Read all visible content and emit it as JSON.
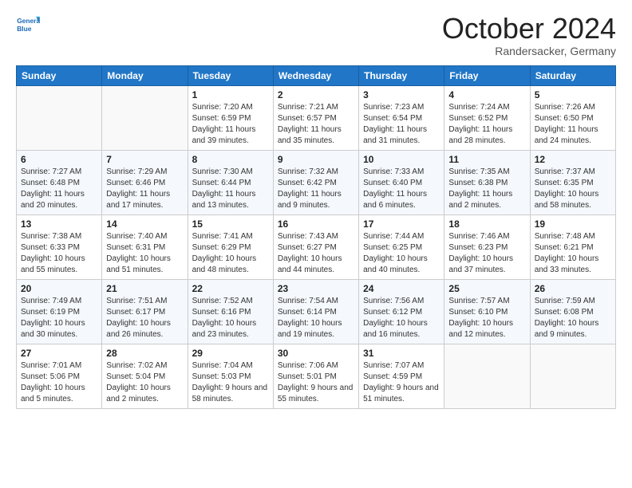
{
  "logo": {
    "line1": "General",
    "line2": "Blue"
  },
  "header": {
    "month": "October 2024",
    "location": "Randersacker, Germany"
  },
  "weekdays": [
    "Sunday",
    "Monday",
    "Tuesday",
    "Wednesday",
    "Thursday",
    "Friday",
    "Saturday"
  ],
  "weeks": [
    [
      {
        "day": "",
        "detail": ""
      },
      {
        "day": "",
        "detail": ""
      },
      {
        "day": "1",
        "detail": "Sunrise: 7:20 AM\nSunset: 6:59 PM\nDaylight: 11 hours and 39 minutes."
      },
      {
        "day": "2",
        "detail": "Sunrise: 7:21 AM\nSunset: 6:57 PM\nDaylight: 11 hours and 35 minutes."
      },
      {
        "day": "3",
        "detail": "Sunrise: 7:23 AM\nSunset: 6:54 PM\nDaylight: 11 hours and 31 minutes."
      },
      {
        "day": "4",
        "detail": "Sunrise: 7:24 AM\nSunset: 6:52 PM\nDaylight: 11 hours and 28 minutes."
      },
      {
        "day": "5",
        "detail": "Sunrise: 7:26 AM\nSunset: 6:50 PM\nDaylight: 11 hours and 24 minutes."
      }
    ],
    [
      {
        "day": "6",
        "detail": "Sunrise: 7:27 AM\nSunset: 6:48 PM\nDaylight: 11 hours and 20 minutes."
      },
      {
        "day": "7",
        "detail": "Sunrise: 7:29 AM\nSunset: 6:46 PM\nDaylight: 11 hours and 17 minutes."
      },
      {
        "day": "8",
        "detail": "Sunrise: 7:30 AM\nSunset: 6:44 PM\nDaylight: 11 hours and 13 minutes."
      },
      {
        "day": "9",
        "detail": "Sunrise: 7:32 AM\nSunset: 6:42 PM\nDaylight: 11 hours and 9 minutes."
      },
      {
        "day": "10",
        "detail": "Sunrise: 7:33 AM\nSunset: 6:40 PM\nDaylight: 11 hours and 6 minutes."
      },
      {
        "day": "11",
        "detail": "Sunrise: 7:35 AM\nSunset: 6:38 PM\nDaylight: 11 hours and 2 minutes."
      },
      {
        "day": "12",
        "detail": "Sunrise: 7:37 AM\nSunset: 6:35 PM\nDaylight: 10 hours and 58 minutes."
      }
    ],
    [
      {
        "day": "13",
        "detail": "Sunrise: 7:38 AM\nSunset: 6:33 PM\nDaylight: 10 hours and 55 minutes."
      },
      {
        "day": "14",
        "detail": "Sunrise: 7:40 AM\nSunset: 6:31 PM\nDaylight: 10 hours and 51 minutes."
      },
      {
        "day": "15",
        "detail": "Sunrise: 7:41 AM\nSunset: 6:29 PM\nDaylight: 10 hours and 48 minutes."
      },
      {
        "day": "16",
        "detail": "Sunrise: 7:43 AM\nSunset: 6:27 PM\nDaylight: 10 hours and 44 minutes."
      },
      {
        "day": "17",
        "detail": "Sunrise: 7:44 AM\nSunset: 6:25 PM\nDaylight: 10 hours and 40 minutes."
      },
      {
        "day": "18",
        "detail": "Sunrise: 7:46 AM\nSunset: 6:23 PM\nDaylight: 10 hours and 37 minutes."
      },
      {
        "day": "19",
        "detail": "Sunrise: 7:48 AM\nSunset: 6:21 PM\nDaylight: 10 hours and 33 minutes."
      }
    ],
    [
      {
        "day": "20",
        "detail": "Sunrise: 7:49 AM\nSunset: 6:19 PM\nDaylight: 10 hours and 30 minutes."
      },
      {
        "day": "21",
        "detail": "Sunrise: 7:51 AM\nSunset: 6:17 PM\nDaylight: 10 hours and 26 minutes."
      },
      {
        "day": "22",
        "detail": "Sunrise: 7:52 AM\nSunset: 6:16 PM\nDaylight: 10 hours and 23 minutes."
      },
      {
        "day": "23",
        "detail": "Sunrise: 7:54 AM\nSunset: 6:14 PM\nDaylight: 10 hours and 19 minutes."
      },
      {
        "day": "24",
        "detail": "Sunrise: 7:56 AM\nSunset: 6:12 PM\nDaylight: 10 hours and 16 minutes."
      },
      {
        "day": "25",
        "detail": "Sunrise: 7:57 AM\nSunset: 6:10 PM\nDaylight: 10 hours and 12 minutes."
      },
      {
        "day": "26",
        "detail": "Sunrise: 7:59 AM\nSunset: 6:08 PM\nDaylight: 10 hours and 9 minutes."
      }
    ],
    [
      {
        "day": "27",
        "detail": "Sunrise: 7:01 AM\nSunset: 5:06 PM\nDaylight: 10 hours and 5 minutes."
      },
      {
        "day": "28",
        "detail": "Sunrise: 7:02 AM\nSunset: 5:04 PM\nDaylight: 10 hours and 2 minutes."
      },
      {
        "day": "29",
        "detail": "Sunrise: 7:04 AM\nSunset: 5:03 PM\nDaylight: 9 hours and 58 minutes."
      },
      {
        "day": "30",
        "detail": "Sunrise: 7:06 AM\nSunset: 5:01 PM\nDaylight: 9 hours and 55 minutes."
      },
      {
        "day": "31",
        "detail": "Sunrise: 7:07 AM\nSunset: 4:59 PM\nDaylight: 9 hours and 51 minutes."
      },
      {
        "day": "",
        "detail": ""
      },
      {
        "day": "",
        "detail": ""
      }
    ]
  ]
}
